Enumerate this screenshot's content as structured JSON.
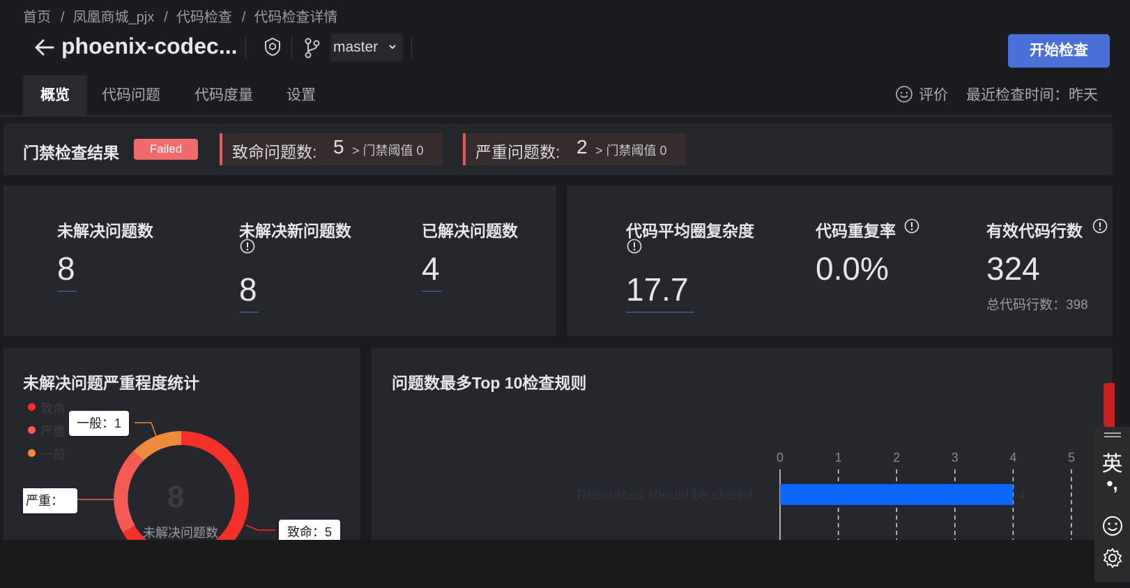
{
  "breadcrumb": [
    "首页",
    "凤凰商城_pjx",
    "代码检查",
    "代码检查详情"
  ],
  "header": {
    "repo_title": "phoenix-codec...",
    "branch": "master",
    "start_button": "开始检查"
  },
  "tabs": [
    {
      "label": "概览",
      "active": true
    },
    {
      "label": "代码问题",
      "active": false
    },
    {
      "label": "代码度量",
      "active": false
    },
    {
      "label": "设置",
      "active": false
    }
  ],
  "rating_label": "评价",
  "last_check": "最近检查时间：昨天",
  "gate": {
    "title": "门禁检查结果",
    "status": "Failed",
    "fatal": {
      "label": "致命问题数:",
      "value": "5",
      "threshold": "> 门禁阈值 0"
    },
    "serious": {
      "label": "严重问题数:",
      "value": "2",
      "threshold": "> 门禁阈值 0"
    }
  },
  "issues_metrics": [
    {
      "label": "未解决问题数",
      "value": "8"
    },
    {
      "label": "未解决新问题数",
      "value": "8"
    },
    {
      "label": "已解决问题数",
      "value": "4"
    }
  ],
  "code_metrics": [
    {
      "label": "代码平均圈复杂度",
      "value": "17.7"
    },
    {
      "label": "代码重复率",
      "value": "0.0%"
    },
    {
      "label": "有效代码行数",
      "value": "324",
      "note": "总代码行数：398"
    }
  ],
  "severity_panel": {
    "title": "未解决问题严重程度统计",
    "legend": [
      {
        "label": "致命",
        "color": "#f4302b"
      },
      {
        "label": "严重",
        "color": "#f55b55"
      },
      {
        "label": "一般",
        "color": "#ee8a3c"
      }
    ],
    "center_value": "8",
    "center_label": "未解决问题数",
    "callouts": {
      "general": "一般：1",
      "serious": "严重：",
      "fatal": "致命：5"
    }
  },
  "top_rules_panel": {
    "title": "问题数最多Top 10检查规则"
  },
  "chart_data": {
    "type": "bar",
    "orientation": "horizontal",
    "categories": [
      "Resources should be closed"
    ],
    "values": [
      4
    ],
    "xlim": [
      0,
      5
    ],
    "xticks": [
      "0",
      "1",
      "2",
      "3",
      "4",
      "5"
    ],
    "bar_color": "#0a68ff",
    "data_labels": [
      "4"
    ],
    "grid": "dashed vertical"
  },
  "ime_toolbar": {
    "lang": "英",
    "punct": "•,"
  }
}
